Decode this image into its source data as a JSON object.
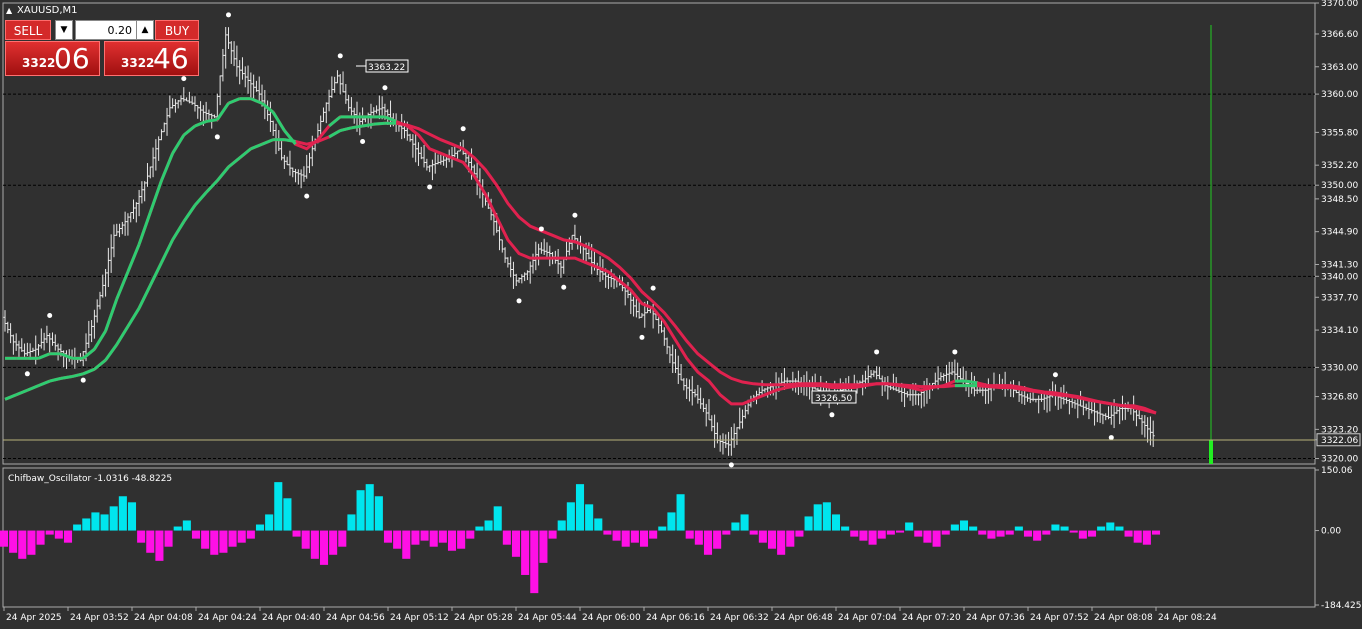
{
  "window": {
    "symbol_title": "XAUUSD,M1"
  },
  "trade_panel": {
    "sell_label": "SELL",
    "buy_label": "BUY",
    "lot_value": "0.20",
    "sell_price_prefix": "3322",
    "sell_price_big": "06",
    "buy_price_prefix": "3322",
    "buy_price_big": "46"
  },
  "chart_data": [
    {
      "type": "candlestick",
      "title": "XAUUSD,M1",
      "y_ticks": [
        "3370.00",
        "3366.60",
        "3363.00",
        "3360.00",
        "3355.80",
        "3352.20",
        "3350.00",
        "3348.50",
        "3344.90",
        "3341.30",
        "3340.00",
        "3337.70",
        "3334.10",
        "3330.00",
        "3326.80",
        "3323.20",
        "3322.06",
        "3320.00"
      ],
      "ylim": [
        3319.4,
        3370.0
      ],
      "horizontal_levels": [
        3360.0,
        3350.0,
        3340.0,
        3330.0,
        3320.0
      ],
      "current_price": 3322.06,
      "x_labels": [
        "24 Apr 2025",
        "24 Apr 03:52",
        "24 Apr 04:08",
        "24 Apr 04:24",
        "24 Apr 04:40",
        "24 Apr 04:56",
        "24 Apr 05:12",
        "24 Apr 05:28",
        "24 Apr 05:44",
        "24 Apr 06:00",
        "24 Apr 06:16",
        "24 Apr 06:32",
        "24 Apr 06:48",
        "24 Apr 07:04",
        "24 Apr 07:20",
        "24 Apr 07:36",
        "24 Apr 07:52",
        "24 Apr 08:08",
        "24 Apr 08:24"
      ],
      "price_labels": [
        "3363.22",
        "3326.50"
      ],
      "close_path": [
        3335.5,
        3332.8,
        3331.5,
        3332.0,
        3333.5,
        3332.0,
        3331.0,
        3330.8,
        3334.5,
        3339.0,
        3344.5,
        3346.0,
        3348.0,
        3351.0,
        3355.0,
        3358.5,
        3359.5,
        3359.0,
        3358.0,
        3357.5,
        3366.5,
        3363.0,
        3361.5,
        3360.0,
        3357.0,
        3353.0,
        3351.5,
        3351.0,
        3355.0,
        3359.0,
        3362.0,
        3358.5,
        3357.0,
        3358.0,
        3358.5,
        3357.0,
        3356.0,
        3354.0,
        3352.0,
        3352.5,
        3353.0,
        3354.0,
        3352.0,
        3349.0,
        3346.0,
        3342.0,
        3339.5,
        3340.5,
        3343.0,
        3342.5,
        3341.0,
        3344.5,
        3343.0,
        3341.0,
        3340.0,
        3339.5,
        3338.0,
        3335.5,
        3336.5,
        3334.0,
        3330.5,
        3328.0,
        3327.0,
        3325.0,
        3322.0,
        3321.5,
        3324.0,
        3326.5,
        3327.5,
        3328.0,
        3328.5,
        3328.5,
        3328.0,
        3327.5,
        3327.0,
        3327.5,
        3328.0,
        3328.5,
        3329.5,
        3328.0,
        3327.5,
        3327.0,
        3327.0,
        3328.0,
        3329.0,
        3329.5,
        3328.5,
        3327.5,
        3327.5,
        3328.0,
        3328.0,
        3327.0,
        3326.5,
        3326.5,
        3327.0,
        3326.5,
        3326.0,
        3325.5,
        3325.0,
        3324.5,
        3325.5,
        3325.5,
        3324.0,
        3322.5
      ],
      "ema_fast": [
        3331.0,
        3331.0,
        3331.0,
        3331.0,
        3331.5,
        3331.5,
        3331.0,
        3331.0,
        3332.0,
        3334.0,
        3337.5,
        3340.5,
        3343.5,
        3347.0,
        3350.5,
        3353.5,
        3355.5,
        3356.5,
        3357.0,
        3357.2,
        3359.0,
        3359.5,
        3359.5,
        3359.0,
        3358.0,
        3356.0,
        3354.5,
        3354.0,
        3355.0,
        3356.5,
        3357.5,
        3357.5,
        3357.5,
        3357.5,
        3357.5,
        3357.0,
        3356.5,
        3355.5,
        3354.0,
        3353.5,
        3353.0,
        3352.5,
        3351.0,
        3349.0,
        3346.5,
        3344.0,
        3342.5,
        3342.0,
        3342.0,
        3342.0,
        3342.0,
        3342.0,
        3341.5,
        3341.0,
        3340.5,
        3339.5,
        3338.5,
        3337.0,
        3336.5,
        3335.0,
        3333.0,
        3331.0,
        3329.5,
        3328.5,
        3327.0,
        3326.0,
        3326.0,
        3326.5,
        3327.0,
        3327.5,
        3327.8,
        3328.0,
        3328.0,
        3328.0,
        3327.8,
        3327.8,
        3327.8,
        3328.0,
        3328.2,
        3328.2,
        3328.0,
        3327.8,
        3327.5,
        3327.8,
        3328.0,
        3328.5,
        3328.5,
        3328.3,
        3328.0,
        3328.0,
        3328.0,
        3327.8,
        3327.5,
        3327.3,
        3327.2,
        3327.0,
        3326.8,
        3326.5,
        3326.2,
        3326.0,
        3325.8,
        3325.8,
        3325.5,
        3325.0
      ],
      "ema_slow": [
        3326.5,
        3327.0,
        3327.5,
        3328.0,
        3328.5,
        3328.8,
        3329.0,
        3329.3,
        3329.8,
        3330.8,
        3332.5,
        3334.5,
        3336.5,
        3339.0,
        3341.5,
        3344.0,
        3346.0,
        3347.8,
        3349.2,
        3350.5,
        3352.0,
        3353.0,
        3354.0,
        3354.5,
        3355.0,
        3355.0,
        3354.8,
        3354.5,
        3354.8,
        3355.3,
        3356.0,
        3356.3,
        3356.5,
        3356.7,
        3356.8,
        3356.8,
        3356.6,
        3356.2,
        3355.6,
        3355.0,
        3354.5,
        3354.0,
        3353.0,
        3351.7,
        3350.0,
        3348.0,
        3346.5,
        3345.5,
        3345.0,
        3344.5,
        3344.0,
        3343.8,
        3343.3,
        3342.7,
        3342.0,
        3341.0,
        3339.8,
        3338.3,
        3337.2,
        3336.0,
        3334.5,
        3332.9,
        3331.5,
        3330.5,
        3329.5,
        3328.8,
        3328.4,
        3328.2,
        3328.1,
        3328.1,
        3328.1,
        3328.2,
        3328.2,
        3328.2,
        3328.1,
        3328.1,
        3328.1,
        3328.1,
        3328.2,
        3328.2,
        3328.1,
        3328.0,
        3327.9,
        3327.9,
        3327.9,
        3328.0,
        3328.0,
        3328.0,
        3327.9,
        3327.8,
        3327.8,
        3327.6,
        3327.4,
        3327.2,
        3327.0,
        3326.9,
        3326.7,
        3326.4,
        3326.2,
        3326.0,
        3325.8,
        3325.6,
        3325.3,
        3325.0
      ]
    },
    {
      "type": "bar",
      "title": "Chifbaw_Oscillator -1.0316 -48.8225",
      "y_ticks": [
        "150.06",
        "0.00",
        "-184.4258"
      ],
      "ylim": [
        -184.4258,
        150.06
      ],
      "positive_color": "#00e5ee",
      "negative_color": "#ff10e6",
      "values": [
        -40,
        -55,
        -70,
        -60,
        -35,
        -10,
        -20,
        -30,
        15,
        30,
        45,
        40,
        60,
        85,
        70,
        -30,
        -55,
        -75,
        -40,
        10,
        25,
        -20,
        -45,
        -60,
        -55,
        -40,
        -30,
        -20,
        15,
        40,
        120,
        80,
        -15,
        -45,
        -70,
        -85,
        -60,
        -40,
        40,
        100,
        115,
        85,
        -30,
        -45,
        -70,
        -35,
        -25,
        -40,
        -30,
        -50,
        -45,
        -20,
        10,
        25,
        60,
        -35,
        -65,
        -110,
        -155,
        -80,
        -20,
        25,
        70,
        115,
        65,
        30,
        -10,
        -25,
        -40,
        -30,
        -40,
        -20,
        10,
        45,
        90,
        -20,
        -35,
        -60,
        -45,
        -10,
        20,
        40,
        -10,
        -30,
        -45,
        -60,
        -40,
        -15,
        35,
        65,
        70,
        40,
        10,
        -15,
        -25,
        -35,
        -20,
        -10,
        -5,
        20,
        -15,
        -30,
        -40,
        -10,
        15,
        25,
        10,
        -10,
        -20,
        -15,
        -10,
        10,
        -15,
        -25,
        -10,
        15,
        10,
        -5,
        -20,
        -15,
        10,
        20,
        10,
        -15,
        -30,
        -35,
        -10
      ]
    }
  ]
}
